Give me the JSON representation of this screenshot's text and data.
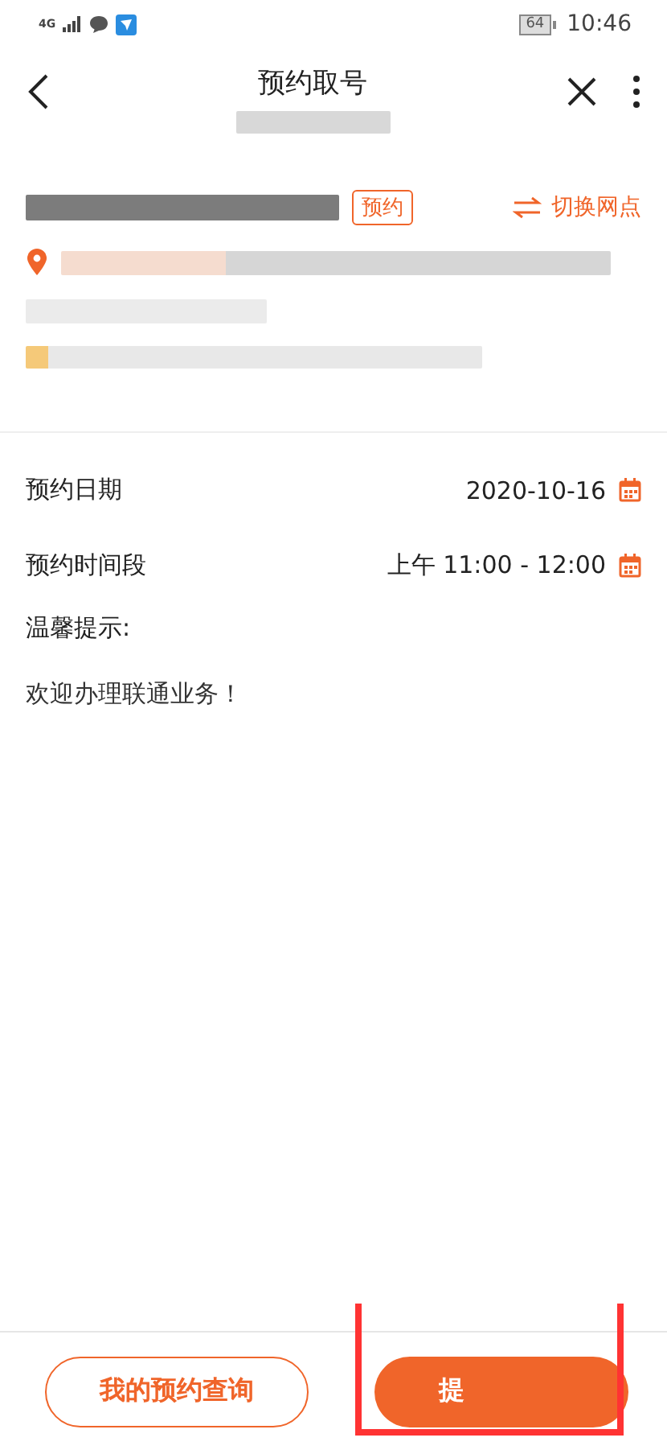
{
  "status_bar": {
    "network": "4G",
    "battery": "64",
    "time": "10:46"
  },
  "header": {
    "title": "预约取号"
  },
  "branch": {
    "tag": "预约",
    "switch_label": "切换网点"
  },
  "form": {
    "rows": [
      {
        "label": "预约日期",
        "value": "2020-10-16"
      },
      {
        "label": "预约时间段",
        "value": "上午 11:00 - 12:00"
      }
    ]
  },
  "tips": {
    "title": "温馨提示:",
    "text": "欢迎办理联通业务！"
  },
  "footer": {
    "buttons": [
      {
        "label": "我的预约查询",
        "kind": "outline"
      },
      {
        "label": "提",
        "kind": "filled"
      }
    ]
  }
}
